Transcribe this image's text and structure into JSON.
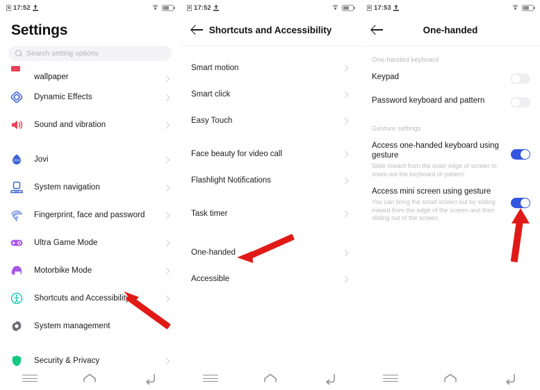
{
  "colors": {
    "accent_blue": "#3355e0",
    "arrow_red": "#e01b17",
    "teal": "#14c8b4",
    "green": "#16c982",
    "purple": "#a855e8",
    "red_pink": "#ea4258",
    "blue_icon": "#3f63d8"
  },
  "panels": [
    {
      "id": "settings",
      "statusbar": {
        "time": "17:52",
        "sim_icon": "sim-icon",
        "upload_icon": "upload-icon",
        "wifi_icon": "wifi-icon",
        "battery_icon": "battery-icon"
      },
      "title": "Settings",
      "search": {
        "placeholder": "Search setting options",
        "icon": "search-icon"
      },
      "groups": [
        {
          "items": [
            {
              "label": "wallpaper",
              "icon": "wallpaper-icon",
              "clipped": true
            },
            {
              "label": "Dynamic Effects",
              "icon": "dynamic-effects-icon"
            },
            {
              "label": "Sound and vibration",
              "icon": "sound-vibration-icon"
            }
          ]
        },
        {
          "items": [
            {
              "label": "Jovi",
              "icon": "jovi-icon"
            },
            {
              "label": "System navigation",
              "icon": "system-navigation-icon"
            },
            {
              "label": "Fingerprint, face and password",
              "icon": "fingerprint-icon"
            },
            {
              "label": "Ultra Game Mode",
              "icon": "ultra-game-mode-icon"
            },
            {
              "label": "Motorbike Mode",
              "icon": "motorbike-mode-icon"
            },
            {
              "label": "Shortcuts and Accessibility",
              "icon": "accessibility-icon"
            },
            {
              "label": "System management",
              "icon": "system-management-icon"
            }
          ]
        },
        {
          "items": [
            {
              "label": "Security & Privacy",
              "icon": "security-privacy-icon"
            }
          ]
        }
      ]
    },
    {
      "id": "shortcuts-accessibility",
      "statusbar": {
        "time": "17:52"
      },
      "title": "Shortcuts and Accessibility",
      "back_icon": "back-arrow-icon",
      "groups": [
        {
          "items": [
            {
              "label": "Smart motion"
            },
            {
              "label": "Smart click"
            },
            {
              "label": "Easy Touch"
            }
          ]
        },
        {
          "items": [
            {
              "label": "Face beauty for video call"
            },
            {
              "label": "Flashlight Notifications"
            }
          ]
        },
        {
          "items": [
            {
              "label": "Task timer"
            }
          ]
        },
        {
          "items": [
            {
              "label": "One-handed"
            },
            {
              "label": "Accessible"
            }
          ]
        }
      ]
    },
    {
      "id": "one-handed",
      "statusbar": {
        "time": "17:53"
      },
      "title": "One-handed",
      "back_icon": "back-arrow-icon",
      "sections": [
        {
          "label": "One-handed keyboard",
          "rows": [
            {
              "title": "Keypad",
              "desc": "",
              "toggle": "off"
            },
            {
              "title": "Password keyboard and pattern",
              "desc": "",
              "toggle": "off"
            }
          ]
        },
        {
          "label": "Gesture settings",
          "rows": [
            {
              "title": "Access one-handed keyboard using gesture",
              "desc": "Slide inward from the outer edge of screen to zoom out the keyboard or pattern.",
              "toggle": "on"
            },
            {
              "title": "Access mini screen using gesture",
              "desc": "You can bring the small screen out by sliding inward from the edge of the screen and then sliding out of the screen.",
              "toggle": "on"
            }
          ]
        }
      ]
    }
  ],
  "navbar": {
    "menu_label": "recents-button",
    "home_label": "home-button",
    "back_label": "back-button"
  },
  "annotations": [
    {
      "name": "arrow-pointing-shortcuts-accessibility",
      "target": "Shortcuts and Accessibility"
    },
    {
      "name": "arrow-pointing-one-handed",
      "target": "One-handed"
    },
    {
      "name": "arrow-pointing-mini-screen-toggle",
      "target": "Access mini screen using gesture"
    }
  ]
}
